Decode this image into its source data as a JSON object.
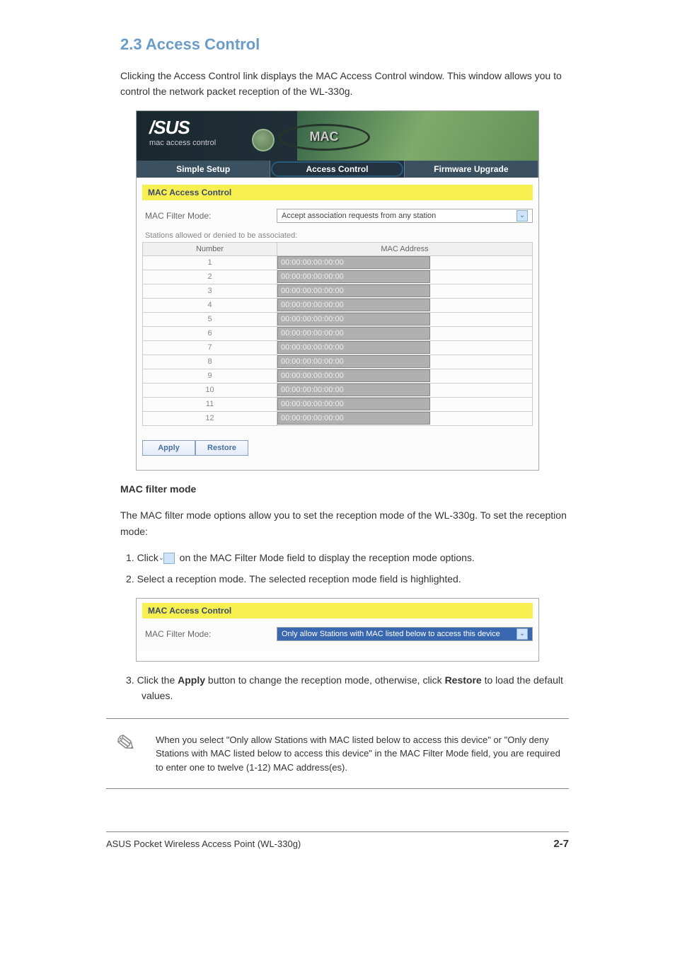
{
  "page": {
    "section_title": "2.3 Access Control",
    "intro_text": "Clicking the Access Control link displays the MAC Access Control window. This window allows you to control the network packet reception of the WL-330g.",
    "mac_filter_mode_heading": "MAC filter mode",
    "mfm_p1": "The MAC filter mode options allow you to set the reception mode of the WL-330g. To set the reception mode:",
    "mfm_step1": "1. Click ",
    "mfm_step1_after": " on the MAC Filter Mode field to display the reception mode options.",
    "mfm_step2": "2. Select a reception mode. The selected reception mode field is highlighted.",
    "mfm_step3_part1": "3. Click the ",
    "mfm_step3_apply": "Apply",
    "mfm_step3_part2": " button to change the reception mode, otherwise, click ",
    "mfm_step3_restore": "Restore",
    "mfm_step3_part3": " to load the default values.",
    "note_text": "When you select \"Only allow Stations with MAC listed below to access this device\" or \"Only deny Stations with MAC listed below to access this device\" in the MAC Filter Mode field, you are required to enter one to twelve (1-12) MAC address(es)."
  },
  "screenshot1": {
    "logo_text": "/SUS",
    "header_subtitle": "mac access control",
    "mac_badge": "MAC",
    "tabs": {
      "simple": "Simple Setup",
      "access": "Access Control",
      "firmware": "Firmware Upgrade"
    },
    "yellow_title": "MAC Access Control",
    "field_label": "MAC Filter Mode:",
    "select_value": "Accept association requests from any station",
    "table_caption": "Stations allowed or denied to be associated:",
    "col_number": "Number",
    "col_mac": "MAC Address",
    "default_mac": "00:00:00:00:00:00",
    "rows": [
      "1",
      "2",
      "3",
      "4",
      "5",
      "6",
      "7",
      "8",
      "9",
      "10",
      "11",
      "12"
    ],
    "btn_apply": "Apply",
    "btn_restore": "Restore"
  },
  "screenshot2": {
    "yellow_title": "MAC Access Control",
    "field_label": "MAC Filter Mode:",
    "select_value": "Only allow Stations with MAC listed below to access this device"
  },
  "footer": {
    "left": "ASUS Pocket Wireless Access Point (WL-330g)",
    "right": "2-7"
  }
}
